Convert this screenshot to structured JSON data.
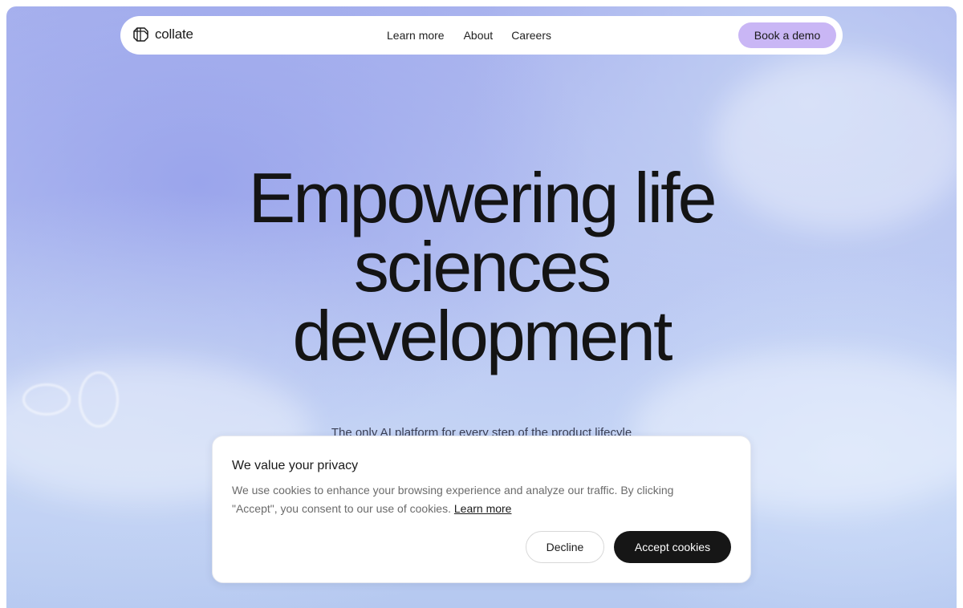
{
  "nav": {
    "logo_text": "collate",
    "links": [
      "Learn more",
      "About",
      "Careers"
    ],
    "cta_label": "Book a demo"
  },
  "hero": {
    "title_lines": [
      "Empowering life",
      "sciences",
      "development"
    ],
    "subtitle": "The only AI platform for every step of the product lifecyle"
  },
  "cookie_banner": {
    "title": "We value your privacy",
    "text": "We use cookies to enhance your browsing experience and analyze our traffic. By clicking \"Accept\", you consent to our use of cookies.",
    "link_label": "Learn more",
    "decline_label": "Decline",
    "accept_label": "Accept cookies"
  },
  "colors": {
    "cta_bg": "#c9b6f5",
    "accept_bg": "#161616",
    "title_color": "#141414"
  },
  "icons": {
    "logo": "collate-logo-icon"
  }
}
